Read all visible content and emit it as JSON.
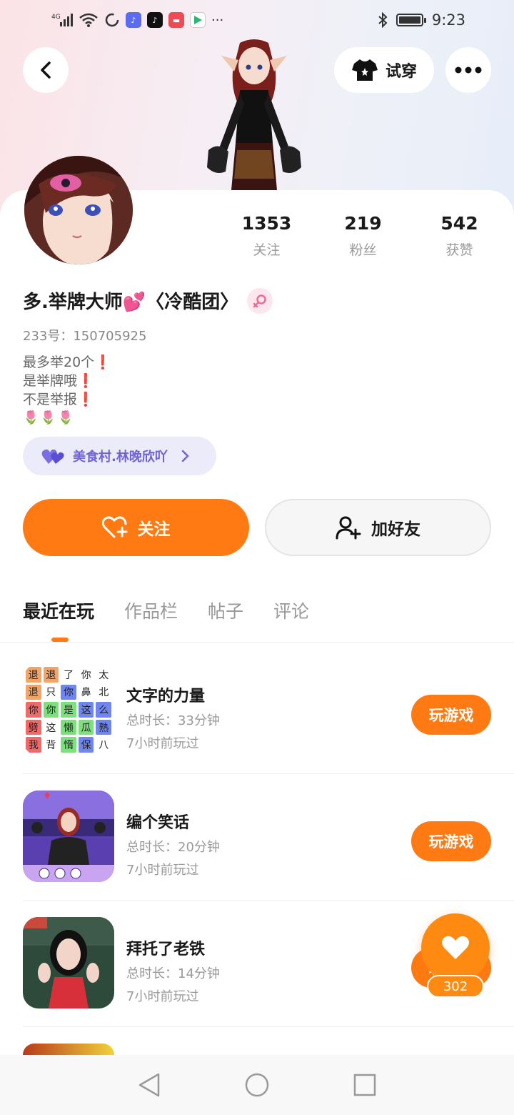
{
  "status_bar": {
    "network": "4G",
    "time": "9:23",
    "more": "···"
  },
  "top": {
    "tryon_label": "试穿"
  },
  "profile": {
    "nickname": "多.举牌大师💕〈冷酷团〉",
    "uid": "233号：150705925",
    "bio_lines": [
      "最多举20个",
      "是举牌哦",
      "不是举报"
    ],
    "bio_mark": "❗",
    "tulips": "🌷🌷🌷",
    "relation_chip": "美食村.林晚欣吖",
    "stats": [
      {
        "value": "1353",
        "label": "关注"
      },
      {
        "value": "219",
        "label": "粉丝"
      },
      {
        "value": "542",
        "label": "获赞"
      }
    ]
  },
  "actions": {
    "follow": "关注",
    "add_friend": "加好友"
  },
  "tabs": [
    "最近在玩",
    "作品栏",
    "帖子",
    "评论"
  ],
  "games": [
    {
      "title": "文字的力量",
      "duration": "总时长：33分钟",
      "last_played": "7小时前玩过",
      "button": "玩游戏"
    },
    {
      "title": "编个笑话",
      "duration": "总时长：20分钟",
      "last_played": "7小时前玩过",
      "button": "玩游戏"
    },
    {
      "title": "拜托了老铁",
      "duration": "总时长：14分钟",
      "last_played": "7小时前玩过",
      "button": "玩游戏"
    }
  ],
  "word_grid": [
    "退",
    "退",
    "了",
    "你",
    "太",
    "退",
    "只",
    "你",
    "鼻",
    "北",
    "你",
    "你",
    "是",
    "这",
    "么",
    "劈",
    "这",
    "懒",
    "瓜",
    "熟",
    "我",
    "背",
    "惰",
    "保",
    "八"
  ],
  "floating_like": {
    "count": "302"
  },
  "colors": {
    "accent": "#ff7a12",
    "chip_text": "#6f63d6",
    "chip_bg": "#ecebf9"
  }
}
